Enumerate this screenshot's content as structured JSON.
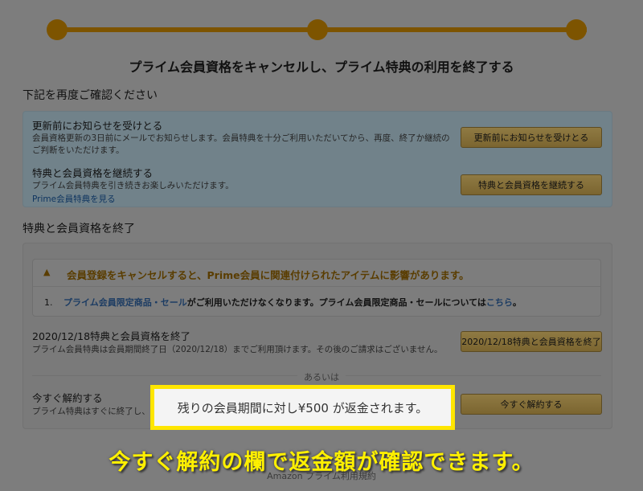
{
  "title": "プライム会員資格をキャンセルし、プライム特典の利用を終了する",
  "confirm_heading": "下記を再度ご確認ください",
  "notify_row": {
    "title": "更新前にお知らせを受けとる",
    "description": "会員資格更新の3日前にメールでお知らせします。会員特典を十分ご利用いただいてから、再度、終了か継続のご判断をいただけます。",
    "button": "更新前にお知らせを受けとる"
  },
  "continue_row": {
    "title": "特典と会員資格を継続する",
    "description": "プライム会員特典を引き続きお楽しみいただけます。",
    "link": "Prime会員特典を見る",
    "button": "特典と会員資格を継続する"
  },
  "end_heading": "特典と会員資格を終了",
  "alert": {
    "icon": "warning-icon",
    "title": "会員登録をキャンセルすると、Prime会員に関連付けられたアイテムに影響があります。",
    "item_number": "1.",
    "item_link": "プライム会員限定商品・セール",
    "item_text": "がご利用いただけなくなります。プライム会員限定商品・セールについては",
    "item_here": "こちら",
    "item_end": "。"
  },
  "end_on_date": {
    "title": "2020/12/18特典と会員資格を終了",
    "description": "プライム会員特典は会員期間終了日（2020/12/18）までご利用頂けます。その後のご請求はございません。",
    "button": "2020/12/18特典と会員資格を終了"
  },
  "or_label": "あるいは",
  "cancel_now": {
    "title": "今すぐ解約する",
    "description": "プライム特典はすぐに終了し、",
    "button": "今すぐ解約する"
  },
  "callout": "残りの会員期間に対し¥500 が返金されます。",
  "caption": "今すぐ解約の欄で返金額が確認できます。",
  "footer": "Amazon プライム利用規約",
  "colors": {
    "accent": "#7d5400",
    "highlight": "#ffe600",
    "caption": "#fff000"
  }
}
